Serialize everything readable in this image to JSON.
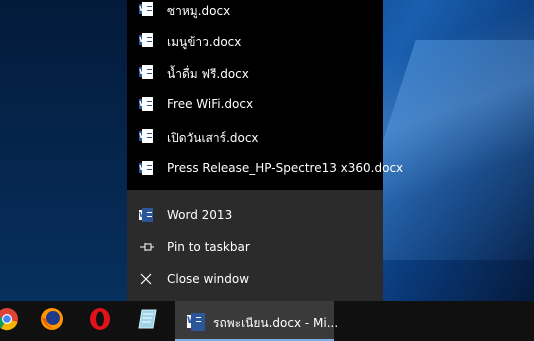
{
  "recent_files": [
    {
      "label": "ซาหมู.docx",
      "icon": "word-doc-icon"
    },
    {
      "label": "เมนูข้าว.docx",
      "icon": "word-doc-icon"
    },
    {
      "label": "น้ำดื่ม ฟรี.docx",
      "icon": "word-doc-icon"
    },
    {
      "label": "Free WiFi.docx",
      "icon": "word-doc-icon"
    },
    {
      "label": "เปิดวันเสาร์.docx",
      "icon": "word-doc-icon"
    },
    {
      "label": "Press Release_HP-Spectre13 x360.docx",
      "icon": "word-doc-icon"
    }
  ],
  "tasks": {
    "app": {
      "label": "Word 2013",
      "icon": "word-app-icon"
    },
    "pin": {
      "label": "Pin to taskbar",
      "icon": "pin-icon"
    },
    "close": {
      "label": "Close window",
      "icon": "close-icon"
    }
  },
  "taskbar": {
    "apps": [
      "chrome-icon",
      "firefox-icon",
      "opera-icon",
      "notepad-icon"
    ],
    "active_window": {
      "label": "รถพะเนียน.docx - Mi...",
      "icon": "word-app-icon"
    }
  },
  "colors": {
    "word_blue": "#2b579a",
    "menu_bg": "#2b2b2b",
    "recent_bg": "#000000",
    "taskbar_bg": "#101010"
  }
}
